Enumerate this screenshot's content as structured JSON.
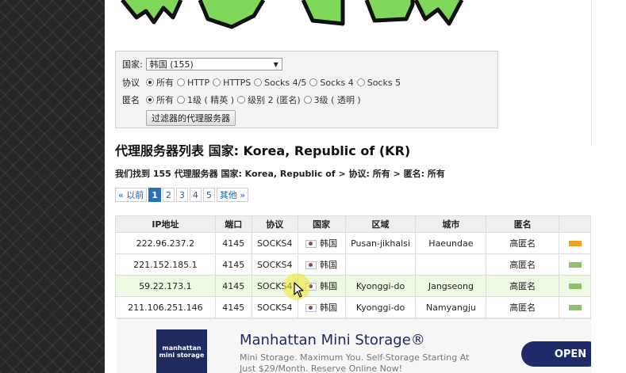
{
  "filter": {
    "country_label": "国家:",
    "country_value": "韩国 (155)",
    "protocol_label": "协议",
    "protocol_options": [
      "所有",
      "HTTP",
      "HTTPS",
      "Socks 4/5",
      "Socks 4",
      "Socks 5"
    ],
    "anon_label": "匿名",
    "anon_options": [
      "所有",
      "1级 ( 精英 )",
      "级别 2 (匿名)",
      "3级 ( 透明 )"
    ],
    "submit_label": "过滤器的代理服务器"
  },
  "title": "代理服务器列表 国家: Korea, Republic of (KR)",
  "summary": "我们找到 155 代理服务器 国家: Korea, Republic of > 协议: 所有 > 匿名: 所有",
  "pager": {
    "prev": "« 以前",
    "pages": [
      "1",
      "2",
      "3",
      "4",
      "5"
    ],
    "next": "其他 »"
  },
  "table": {
    "headers": [
      "IP地址",
      "端口",
      "协议",
      "国家",
      "区域",
      "城市",
      "匿名"
    ],
    "rows": [
      {
        "ip": "222.96.237.2",
        "port": "4145",
        "protocol": "SOCKS4",
        "country": "韩国",
        "region": "Pusan-jikhalsi",
        "city": "Haeundae",
        "anon": "高匿名",
        "speed_color": "#f0a020"
      },
      {
        "ip": "221.152.185.1",
        "port": "4145",
        "protocol": "SOCKS4",
        "country": "韩国",
        "region": "",
        "city": "",
        "anon": "高匿名",
        "speed_color": "#8bc26b"
      },
      {
        "ip": "59.22.173.1",
        "port": "4145",
        "protocol": "SOCKS4",
        "country": "韩国",
        "region": "Kyonggi-do",
        "city": "Jangseong",
        "anon": "高匿名",
        "speed_color": "#8bc26b"
      },
      {
        "ip": "211.106.251.146",
        "port": "4145",
        "protocol": "SOCKS4",
        "country": "韩国",
        "region": "Kyonggi-do",
        "city": "Namyangju",
        "anon": "高匿名",
        "speed_color": "#8bc26b"
      }
    ]
  },
  "ad": {
    "logo_text": "manhattan mini storage",
    "title": "Manhattan Mini Storage®",
    "desc": "Mini Storage. Maximum You. Self-Storage Starting At Just $29/Month. Reserve Online Now!",
    "cta": "OPEN"
  }
}
